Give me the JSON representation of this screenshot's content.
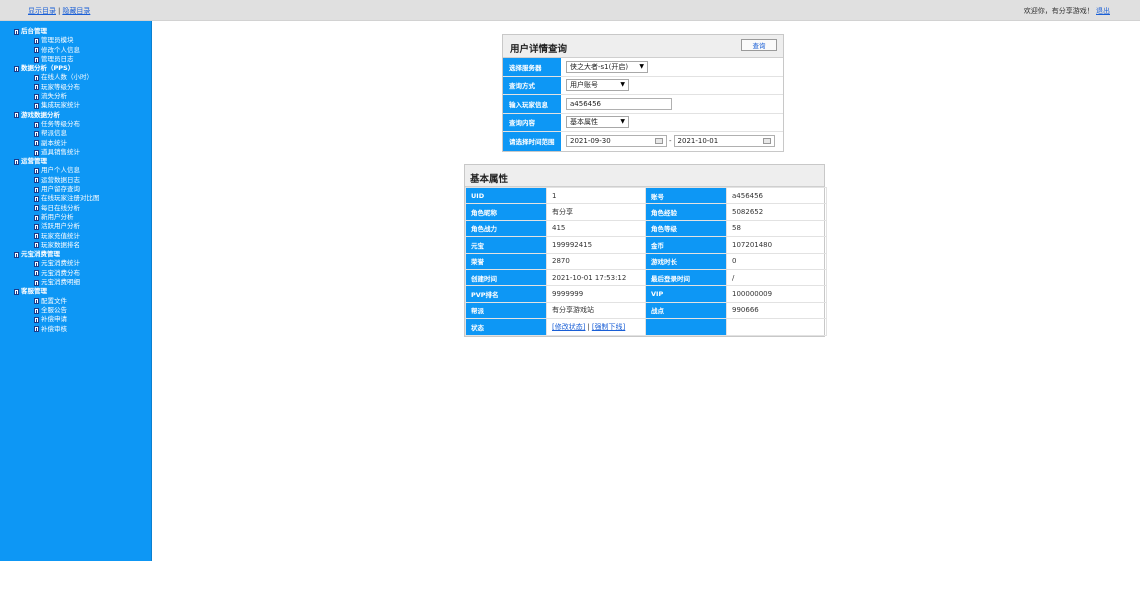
{
  "topbar": {
    "show_menu": "显示目录",
    "sep": "|",
    "hide_menu": "隐藏目录",
    "welcome": "欢迎你，有分享游戏！",
    "logout": "退出"
  },
  "sidebar": {
    "items": [
      {
        "label": "后台管理",
        "level": 0
      },
      {
        "label": "管理员模块",
        "level": 1
      },
      {
        "label": "修改个人信息",
        "level": 1
      },
      {
        "label": "管理员日志",
        "level": 1
      },
      {
        "label": "数据分析（PPS）",
        "level": 0
      },
      {
        "label": "在线人数（小时）",
        "level": 1
      },
      {
        "label": "玩家等级分布",
        "level": 1
      },
      {
        "label": "流失分析",
        "level": 1
      },
      {
        "label": "集成玩家统计",
        "level": 1
      },
      {
        "label": "游戏数据分析",
        "level": 0
      },
      {
        "label": "任务等级分布",
        "level": 1
      },
      {
        "label": "帮派信息",
        "level": 1
      },
      {
        "label": "副本统计",
        "level": 1
      },
      {
        "label": "道具销售统计",
        "level": 1
      },
      {
        "label": "运营管理",
        "level": 0
      },
      {
        "label": "用户个人信息",
        "level": 1
      },
      {
        "label": "运营数据日志",
        "level": 1
      },
      {
        "label": "用户留存查询",
        "level": 1
      },
      {
        "label": "在线玩家注册对比图",
        "level": 1
      },
      {
        "label": "每日在线分析",
        "level": 1
      },
      {
        "label": "新用户分析",
        "level": 1
      },
      {
        "label": "活跃用户分析",
        "level": 1
      },
      {
        "label": "玩家充值统计",
        "level": 1
      },
      {
        "label": "玩家数据排名",
        "level": 1
      },
      {
        "label": "元宝消费管理",
        "level": 0
      },
      {
        "label": "元宝消费统计",
        "level": 1
      },
      {
        "label": "元宝消费分布",
        "level": 1
      },
      {
        "label": "元宝消费明细",
        "level": 1
      },
      {
        "label": "客服管理",
        "level": 0
      },
      {
        "label": "配置文件",
        "level": 1
      },
      {
        "label": "全服公告",
        "level": 1
      },
      {
        "label": "补偿申请",
        "level": 1
      },
      {
        "label": "补偿审核",
        "level": 1
      }
    ]
  },
  "query": {
    "title": "用户详情查询",
    "button": "查询",
    "server_label": "选择服务器",
    "server_value": "侠之大者-s1(开启)",
    "method_label": "查询方式",
    "method_value": "用户账号",
    "input_label": "输入玩家信息",
    "input_value": "a456456",
    "content_label": "查询内容",
    "content_value": "基本属性",
    "date_label": "请选择时间范围",
    "date_from": "2021-09-30",
    "date_dash": "-",
    "date_to": "2021-10-01"
  },
  "attributes": {
    "title": "基本属性",
    "rows": [
      {
        "k1": "UID",
        "v1": "1",
        "k2": "账号",
        "v2": "a456456"
      },
      {
        "k1": "角色昵称",
        "v1": "有分享",
        "k2": "角色经验",
        "v2": "5082652"
      },
      {
        "k1": "角色战力",
        "v1": "415",
        "k2": "角色等级",
        "v2": "58"
      },
      {
        "k1": "元宝",
        "v1": "199992415",
        "k2": "金币",
        "v2": "107201480"
      },
      {
        "k1": "荣誉",
        "v1": "2870",
        "k2": "游戏时长",
        "v2": "0"
      },
      {
        "k1": "创建时间",
        "v1": "2021-10-01 17:53:12",
        "k2": "最后登录时间",
        "v2": "/"
      },
      {
        "k1": "PVP排名",
        "v1": "9999999",
        "k2": "VIP",
        "v2": "100000009"
      },
      {
        "k1": "帮派",
        "v1": "有分享游戏站",
        "k2": "战点",
        "v2": "990666"
      }
    ],
    "status_label": "状态",
    "status_modify": "[修改状态]",
    "status_sep": "|",
    "status_kick": "[强制下线]"
  }
}
